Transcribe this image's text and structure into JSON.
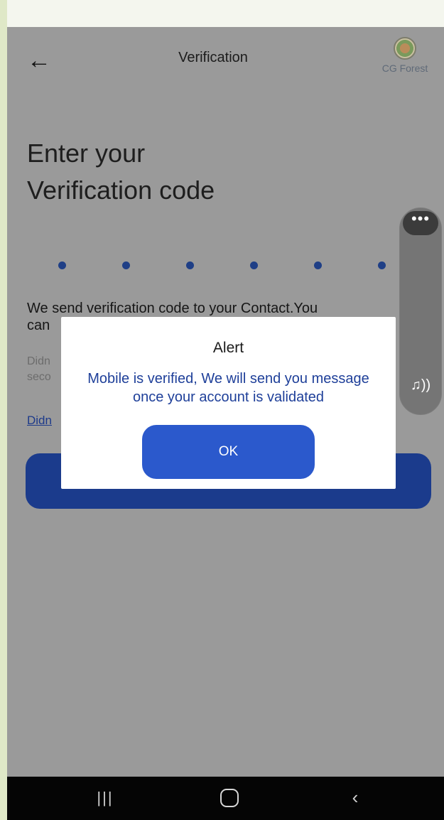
{
  "header": {
    "back_icon": "arrow-left-icon",
    "title": "Verification",
    "logo_text": "CG Forest"
  },
  "main": {
    "heading_line1": "Enter your",
    "heading_line2": "Verification code",
    "otp_dot_count": 6,
    "info_line1": "We send verification code to your Contact.You",
    "info_line2": "can",
    "timer_line1": "Didn",
    "timer_line2": "seco",
    "resend_link": "Didn"
  },
  "side_widget": {
    "more_icon": "more-horizontal-icon",
    "audio_icon": "audio-wave-icon"
  },
  "dialog": {
    "title": "Alert",
    "message": "Mobile is verified, We will send you message once your account is validated",
    "ok_label": "OK"
  },
  "navbar": {
    "recent_icon": "recent-apps-icon",
    "home_icon": "home-icon",
    "back_icon": "back-chevron-icon"
  },
  "colors": {
    "overlay_bg": "#9a9a9a",
    "accent": "#2b59cc",
    "message_text": "#1e3f99",
    "page_frame": "#dfe8c7"
  }
}
